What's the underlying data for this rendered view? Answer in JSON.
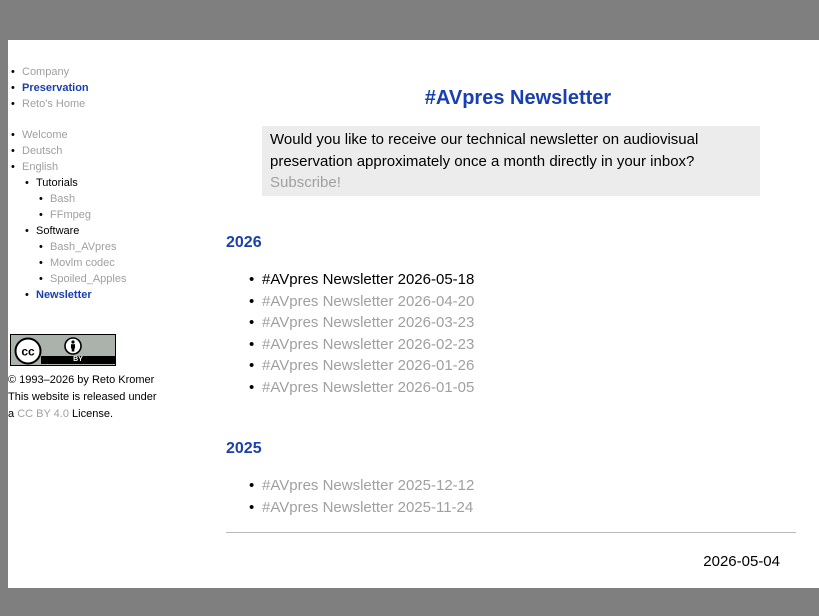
{
  "sidebar": {
    "group1": [
      "Company",
      "Preservation",
      "Reto's Home"
    ],
    "group2": {
      "welcome": "Welcome",
      "deutsch": "Deutsch",
      "english": "English",
      "tutorials": "Tutorials",
      "bash": "Bash",
      "ffmpeg": "FFmpeg",
      "software": "Software",
      "bash_avpres": "Bash_AVpres",
      "movlm": "Movlm codec",
      "spoiled": "Spoiled_Apples",
      "newsletter": "Newsletter"
    },
    "cc_badge": {
      "icon_left": "cc-icon",
      "icon_right": "by-person-icon",
      "label": "BY"
    },
    "license": {
      "copyright": "© 1993–2026 by Reto Kromer",
      "released": "This website is released under",
      "prefix": "a ",
      "link": "CC BY 4.0",
      "suffix": " License."
    }
  },
  "main": {
    "title": "#AVpres Newsletter",
    "promo_text": "Would you like to receive our technical newsletter on audiovisual preservation approximately once a month directly in your inbox?",
    "subscribe": "Subscribe!",
    "years": [
      {
        "year": "2026",
        "items": [
          "#AVpres Newsletter 2026-05-18",
          "#AVpres Newsletter 2026-04-20",
          "#AVpres Newsletter 2026-03-23",
          "#AVpres Newsletter 2026-02-23",
          "#AVpres Newsletter 2026-01-26",
          "#AVpres Newsletter 2026-01-05"
        ]
      },
      {
        "year": "2025",
        "items": [
          "#AVpres Newsletter 2025-12-12",
          "#AVpres Newsletter 2025-11-24"
        ]
      }
    ],
    "footer_date": "2026-05-04"
  },
  "colors": {
    "accent": "#1a3fb0",
    "muted_link": "#a0a0a0",
    "frame": "#7f7f7f",
    "promo_bg": "#ececec"
  }
}
